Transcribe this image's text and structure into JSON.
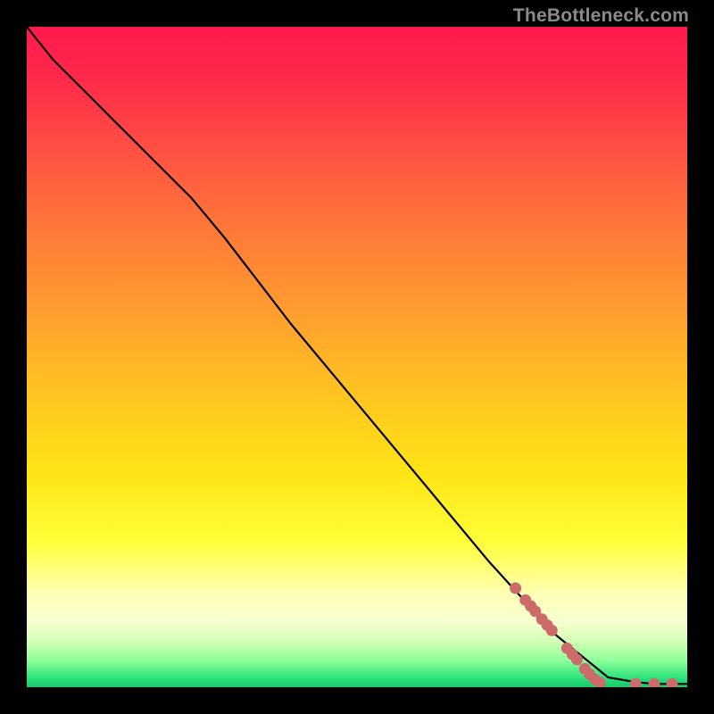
{
  "watermark": "TheBottleneck.com",
  "colors": {
    "marker": "#cd6b6b",
    "curve": "#000000",
    "background": "#000000"
  },
  "chart_data": {
    "type": "line",
    "title": "",
    "xlabel": "",
    "ylabel": "",
    "xlim": [
      0,
      100
    ],
    "ylim": [
      0,
      100
    ],
    "grid": false,
    "note": "Axes and units are not labeled in the source image; x and y are normalized to 0..100 where (0,0) is the lower-left of the colored plot area. Values below are estimated from pixel positions.",
    "series": [
      {
        "name": "curve",
        "kind": "line",
        "x": [
          0,
          4,
          10,
          18,
          25,
          30,
          40,
          50,
          60,
          70,
          80,
          88,
          92,
          95,
          97,
          100
        ],
        "y": [
          100,
          95,
          89,
          81,
          74,
          68,
          55,
          43,
          31,
          19,
          8,
          1.5,
          0.8,
          0.5,
          0.5,
          0.5
        ]
      },
      {
        "name": "markers",
        "kind": "scatter",
        "x": [
          74.0,
          75.5,
          76.3,
          77.0,
          78.0,
          78.8,
          79.5,
          81.8,
          82.6,
          83.3,
          84.5,
          85.2,
          86.0,
          86.8,
          92.2,
          95.0,
          97.7
        ],
        "y": [
          15.0,
          13.2,
          12.3,
          11.5,
          10.3,
          9.4,
          8.6,
          5.9,
          5.0,
          4.2,
          2.8,
          2.0,
          1.2,
          0.7,
          0.5,
          0.5,
          0.5
        ]
      }
    ]
  }
}
